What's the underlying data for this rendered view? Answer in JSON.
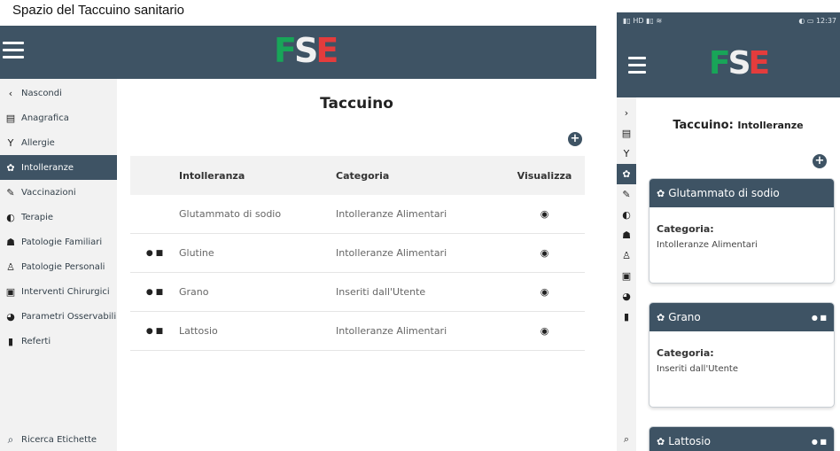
{
  "caption": "Spazio del Taccuino sanitario",
  "desktop": {
    "sidebar": {
      "items": [
        {
          "label": "Nascondi",
          "icon": "‹"
        },
        {
          "label": "Anagrafica",
          "icon": "▤"
        },
        {
          "label": "Allergie",
          "icon": "Y"
        },
        {
          "label": "Intolleranze",
          "icon": "✿"
        },
        {
          "label": "Vaccinazioni",
          "icon": "✎"
        },
        {
          "label": "Terapie",
          "icon": "◐"
        },
        {
          "label": "Patologie Familiari",
          "icon": "☗"
        },
        {
          "label": "Patologie Personali",
          "icon": "♙"
        },
        {
          "label": "Interventi Chirurgici",
          "icon": "▣"
        },
        {
          "label": "Parametri Osservabili",
          "icon": "◕"
        },
        {
          "label": "Referti",
          "icon": "▮"
        }
      ],
      "search_label": "Ricerca Etichette"
    },
    "title": "Taccuino",
    "add_icon": "+",
    "table": {
      "headers": [
        "Intolleranza",
        "Categoria",
        "Visualizza"
      ],
      "rows": [
        {
          "tag": "",
          "name": "Glutammato di sodio",
          "category": "Intolleranze Alimentari"
        },
        {
          "tag": "● ■",
          "name": "Glutine",
          "category": "Intolleranze Alimentari"
        },
        {
          "tag": "● ■",
          "name": "Grano",
          "category": "Inseriti dall'Utente"
        },
        {
          "tag": "● ■",
          "name": "Lattosio",
          "category": "Intolleranze Alimentari"
        }
      ],
      "view_icon": "◉"
    }
  },
  "mobile": {
    "status_left": "HD",
    "status_right": "12:37",
    "title": "Taccuino: ",
    "title_sub": "Intolleranze",
    "add_icon": "+",
    "sidebar_icons": [
      "›",
      "▤",
      "Y",
      "✿",
      "✎",
      "◐",
      "☗",
      "♙",
      "▣",
      "◕",
      "▮"
    ],
    "search_icon": "⌕",
    "cards": [
      {
        "title": "Glutammato di sodio",
        "tag": "",
        "label": "Categoria:",
        "value": "Intolleranze Alimentari"
      },
      {
        "title": "Grano",
        "tag": "● ■",
        "label": "Categoria:",
        "value": "Inseriti dall'Utente"
      },
      {
        "title": "Lattosio",
        "tag": "● ■",
        "label": "",
        "value": ""
      }
    ]
  },
  "logo": {
    "f": "F",
    "s": "S",
    "e": "E"
  },
  "colors": {
    "header": "#3e5364",
    "sidebar": "#f2f2f2"
  }
}
